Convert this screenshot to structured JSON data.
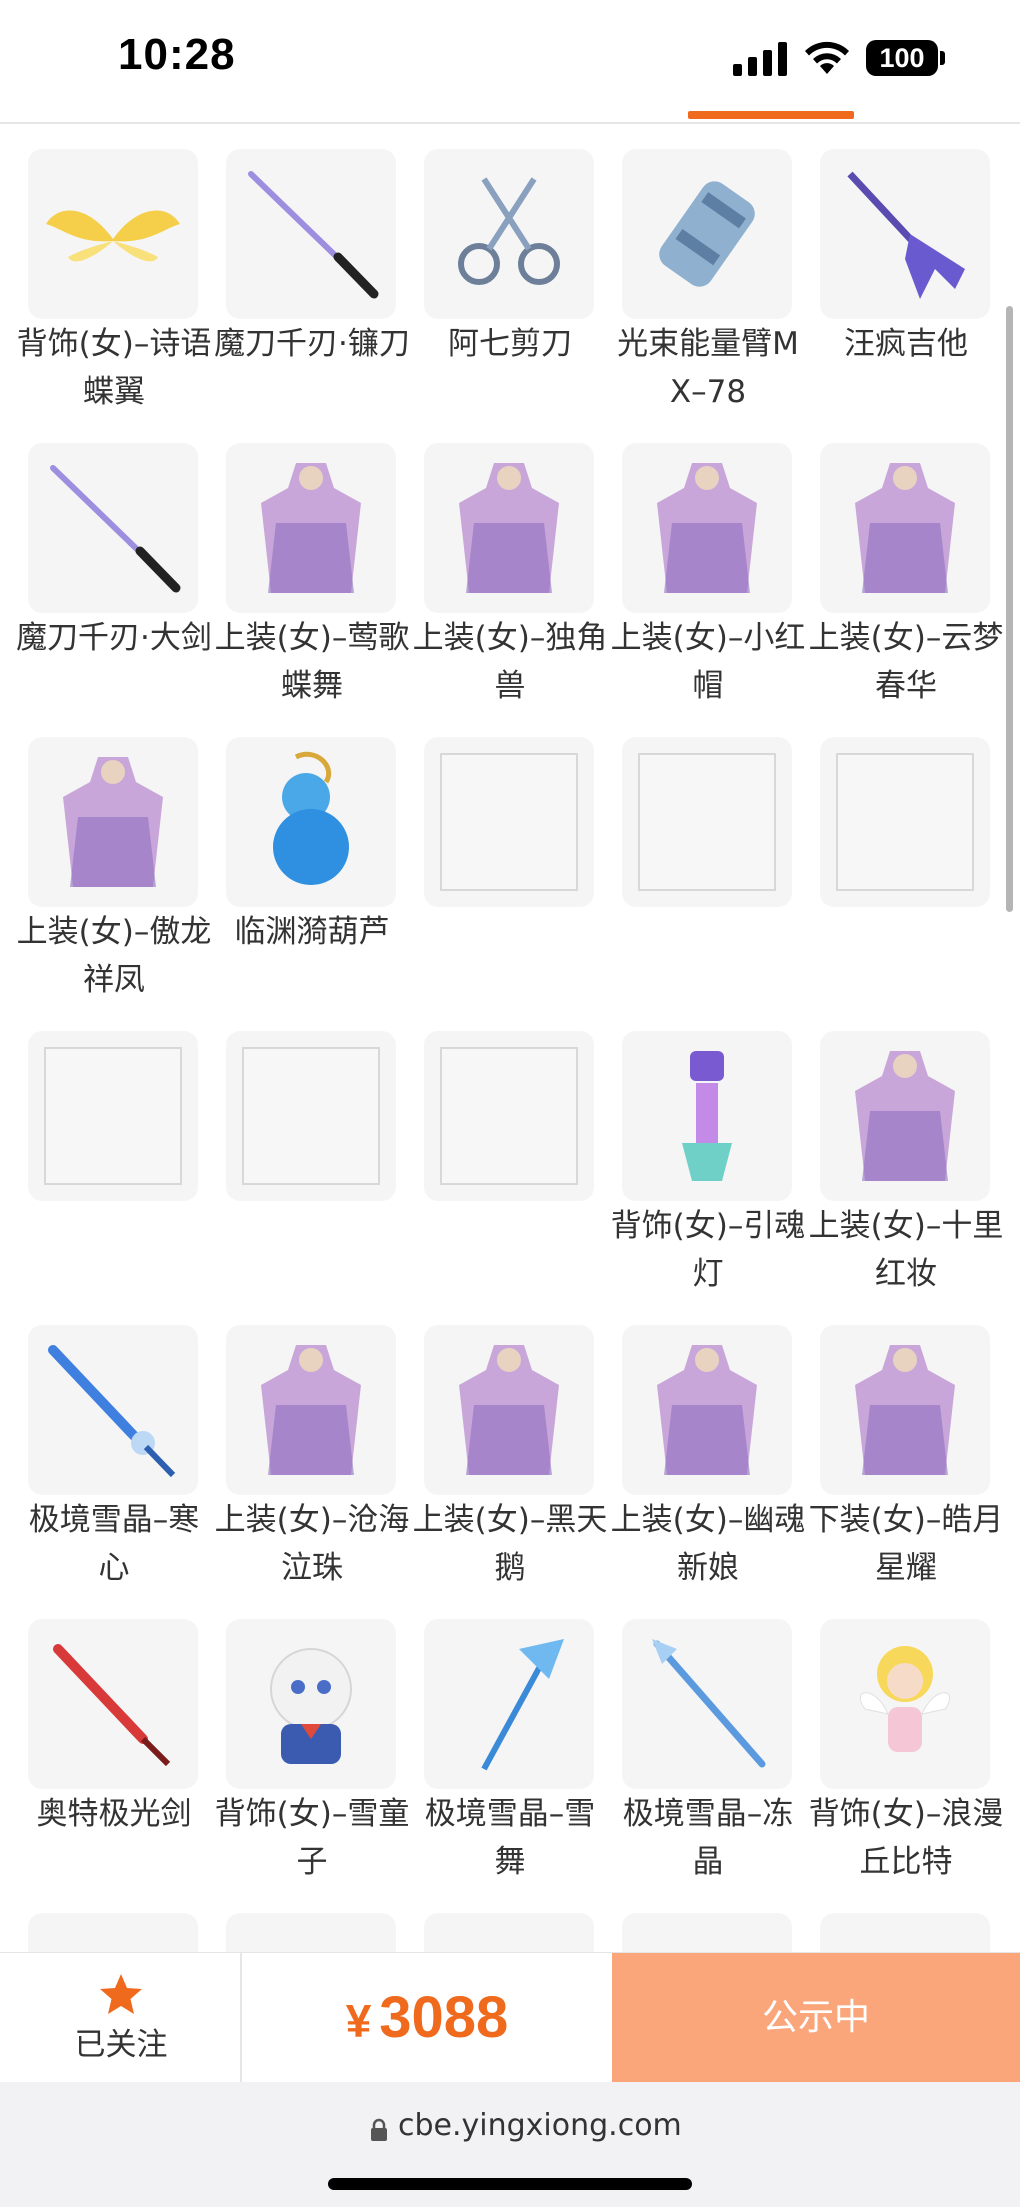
{
  "status_bar": {
    "time": "10:28",
    "battery": "100"
  },
  "items": [
    {
      "name": "背饰(女)–诗语蝶翼",
      "icon": "butterfly-wings-icon"
    },
    {
      "name": "魔刀千刃·镰刀",
      "icon": "katana-icon"
    },
    {
      "name": "阿七剪刀",
      "icon": "scissors-icon"
    },
    {
      "name": "光束能量臂MX–78",
      "icon": "energy-arm-icon"
    },
    {
      "name": "汪疯吉他",
      "icon": "guitar-icon"
    },
    {
      "name": "魔刀千刃·大剑",
      "icon": "katana-icon"
    },
    {
      "name": "上装(女)–莺歌蝶舞",
      "icon": "outfit-icon"
    },
    {
      "name": "上装(女)–独角兽",
      "icon": "outfit-icon"
    },
    {
      "name": "上装(女)–小红帽",
      "icon": "outfit-icon"
    },
    {
      "name": "上装(女)–云梦春华",
      "icon": "outfit-icon"
    },
    {
      "name": "上装(女)–傲龙祥凤",
      "icon": "outfit-icon"
    },
    {
      "name": "临渊漪葫芦",
      "icon": "gourd-icon"
    },
    {
      "name": "",
      "icon": "placeholder-image"
    },
    {
      "name": "",
      "icon": "placeholder-image"
    },
    {
      "name": "",
      "icon": "placeholder-image"
    },
    {
      "name": "",
      "icon": "placeholder-image"
    },
    {
      "name": "",
      "icon": "placeholder-image"
    },
    {
      "name": "",
      "icon": "placeholder-image"
    },
    {
      "name": "背饰(女)–引魂灯",
      "icon": "lantern-icon"
    },
    {
      "name": "上装(女)–十里红妆",
      "icon": "outfit-icon"
    },
    {
      "name": "极境雪晶–寒心",
      "icon": "ice-sword-icon"
    },
    {
      "name": "上装(女)–沧海泣珠",
      "icon": "outfit-icon"
    },
    {
      "name": "上装(女)–黑天鹅",
      "icon": "outfit-icon"
    },
    {
      "name": "上装(女)–幽魂新娘",
      "icon": "outfit-icon"
    },
    {
      "name": "下装(女)–皓月星耀",
      "icon": "outfit-icon"
    },
    {
      "name": "奥特极光剑",
      "icon": "sword-icon"
    },
    {
      "name": "背饰(女)–雪童子",
      "icon": "plush-icon"
    },
    {
      "name": "极境雪晶–雪舞",
      "icon": "ice-scythe-icon"
    },
    {
      "name": "极境雪晶–冻晶",
      "icon": "ice-spear-icon"
    },
    {
      "name": "背饰(女)–浪漫丘比特",
      "icon": "cupid-icon"
    },
    {
      "name": "",
      "icon": "partial-item-icon"
    },
    {
      "name": "",
      "icon": "partial-item-icon"
    },
    {
      "name": "",
      "icon": "partial-item-icon"
    },
    {
      "name": "",
      "icon": "partial-item-icon"
    },
    {
      "name": "",
      "icon": "partial-item-icon"
    }
  ],
  "action_bar": {
    "follow_label": "已关注",
    "currency": "¥",
    "price": "3088",
    "status_label": "公示中"
  },
  "browser": {
    "url": "cbe.yingxiong.com"
  },
  "colors": {
    "accent": "#f06a1d",
    "status_button": "#fba57a",
    "thumb_bg": "#f5f5f5"
  }
}
